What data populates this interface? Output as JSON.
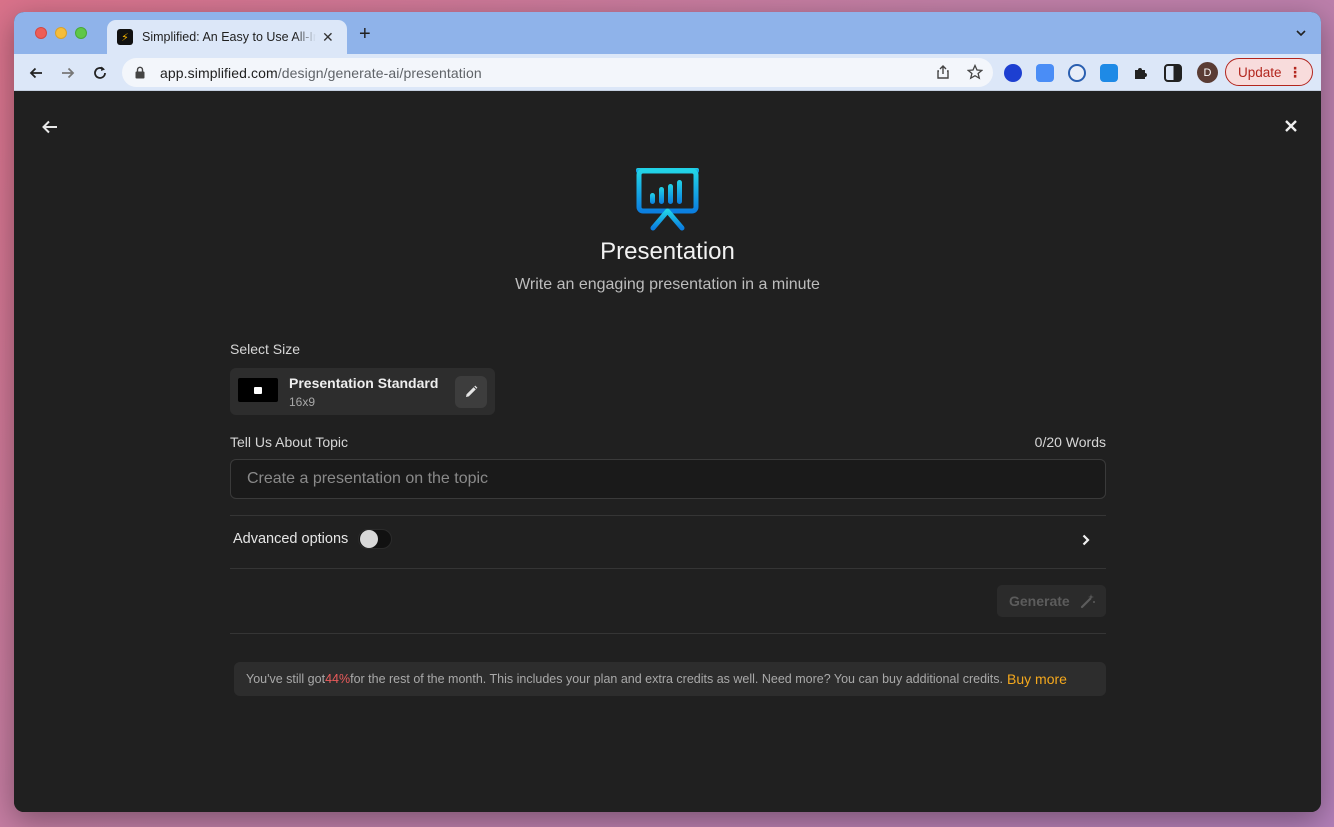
{
  "browser": {
    "tab_title": "Simplified: An Easy to Use All-In-One App",
    "tab_favicon": "⚡",
    "url_domain": "app.simplified.com",
    "url_path": "/design/generate-ai/presentation",
    "profile_initial": "D",
    "update_label": "Update"
  },
  "page": {
    "title": "Presentation",
    "subtitle": "Write an engaging presentation in a minute",
    "select_size_label": "Select Size",
    "size": {
      "name": "Presentation Standard",
      "ratio": "16x9"
    },
    "topic_label": "Tell Us About Topic",
    "word_count": "0/20 Words",
    "topic_placeholder": "Create a presentation on the topic",
    "topic_value": "",
    "advanced_label": "Advanced options",
    "advanced_enabled": false,
    "generate_label": "Generate",
    "credits": {
      "prefix": "You've still got ",
      "percent": "44%",
      "suffix": " for the rest of the month. This includes your plan and extra credits as well. Need more? You can buy additional credits.",
      "buy_label": "Buy more"
    }
  },
  "colors": {
    "accent_blue": "#1aa7ec",
    "credits_percent": "#ea5b5b",
    "buy_more": "#f4a81d",
    "update_red": "#b3261e"
  }
}
